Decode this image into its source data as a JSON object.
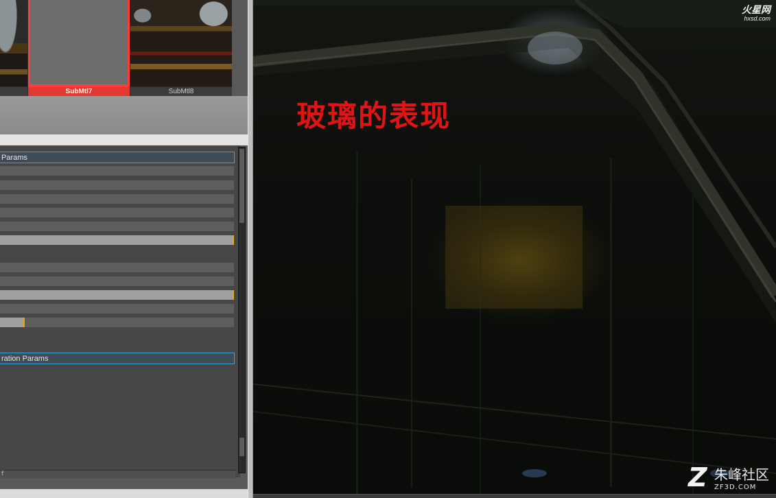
{
  "material_slots": [
    {
      "label": ""
    },
    {
      "label": "SubMtl7",
      "selected": true
    },
    {
      "label": "SubMtl8"
    }
  ],
  "rollouts": {
    "first": "Params",
    "second": "ration Params",
    "bottom_field": "f"
  },
  "slider": {
    "value_fraction": 0.1
  },
  "viewport": {
    "title": "玻璃的表现",
    "logo_top_cn": "火星网",
    "logo_top_en": "hxsd.com",
    "logo_bottom_mark": "Z",
    "logo_bottom_cn": "朱峰社区",
    "logo_bottom_en": "ZF3D.COM"
  },
  "colors": {
    "selected_slot": "#e2382f",
    "rollout_border": "#37a3d8",
    "highlight_tick": "#f0a300",
    "title_red": "#e01414"
  }
}
